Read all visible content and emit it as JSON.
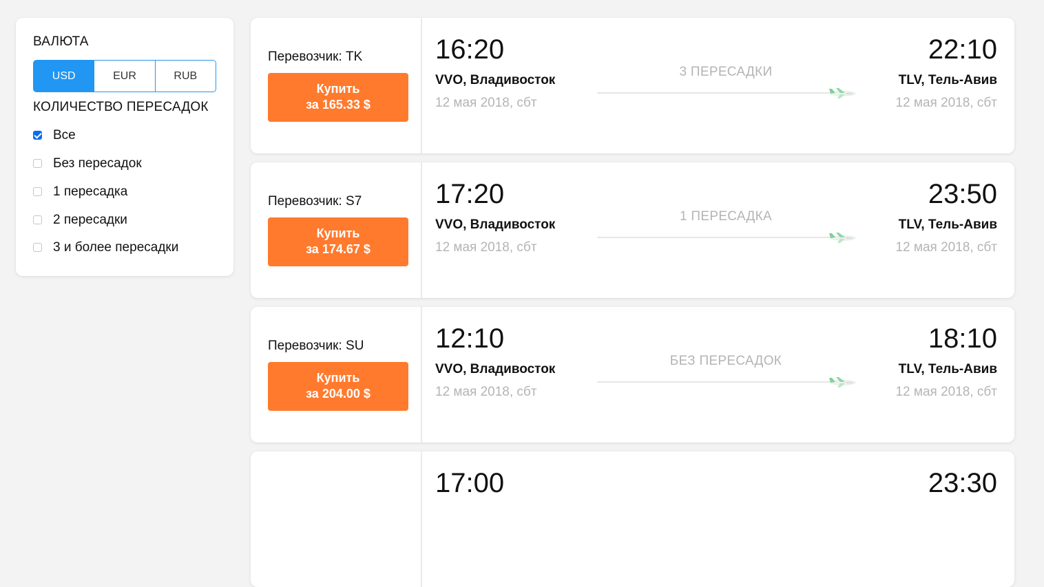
{
  "filters": {
    "currency_title": "ВАЛЮТА",
    "currencies": [
      {
        "label": "USD",
        "active": true
      },
      {
        "label": "EUR",
        "active": false
      },
      {
        "label": "RUB",
        "active": false
      }
    ],
    "stops_title": "КОЛИЧЕСТВО ПЕРЕСАДОК",
    "stops": [
      {
        "label": "Все",
        "checked": true
      },
      {
        "label": "Без пересадок",
        "checked": false
      },
      {
        "label": "1 пересадка",
        "checked": false
      },
      {
        "label": "2 пересадки",
        "checked": false
      },
      {
        "label": "3 и более пересадки",
        "checked": false
      }
    ]
  },
  "tickets": [
    {
      "carrier": "Перевозчик: TK",
      "buy_label": "Купить",
      "price": "за 165.33 $",
      "departure_time": "16:20",
      "departure_city": "VVO, Владивосток",
      "departure_date": "12 мая 2018, сбт",
      "stops": "3 ПЕРЕСАДКИ",
      "arrival_time": "22:10",
      "arrival_city": "TLV, Тель-Авив",
      "arrival_date": "12 мая 2018, сбт"
    },
    {
      "carrier": "Перевозчик: S7",
      "buy_label": "Купить",
      "price": "за 174.67 $",
      "departure_time": "17:20",
      "departure_city": "VVO, Владивосток",
      "departure_date": "12 мая 2018, сбт",
      "stops": "1 ПЕРЕСАДКА",
      "arrival_time": "23:50",
      "arrival_city": "TLV, Тель-Авив",
      "arrival_date": "12 мая 2018, сбт"
    },
    {
      "carrier": "Перевозчик: SU",
      "buy_label": "Купить",
      "price": "за 204.00 $",
      "departure_time": "12:10",
      "departure_city": "VVO, Владивосток",
      "departure_date": "12 мая 2018, сбт",
      "stops": "БЕЗ ПЕРЕСАДОК",
      "arrival_time": "18:10",
      "arrival_city": "TLV, Тель-Авив",
      "arrival_date": "12 мая 2018, сбт"
    },
    {
      "carrier": "",
      "buy_label": "",
      "price": "",
      "departure_time": "17:00",
      "departure_city": "",
      "departure_date": "",
      "stops": "",
      "arrival_time": "23:30",
      "arrival_city": "",
      "arrival_date": ""
    }
  ],
  "colors": {
    "accent_blue": "#2196f3",
    "buy_orange": "#ff7a2d",
    "muted_text": "#b4b4b4"
  },
  "icons": {
    "plane": "airplane-icon"
  }
}
